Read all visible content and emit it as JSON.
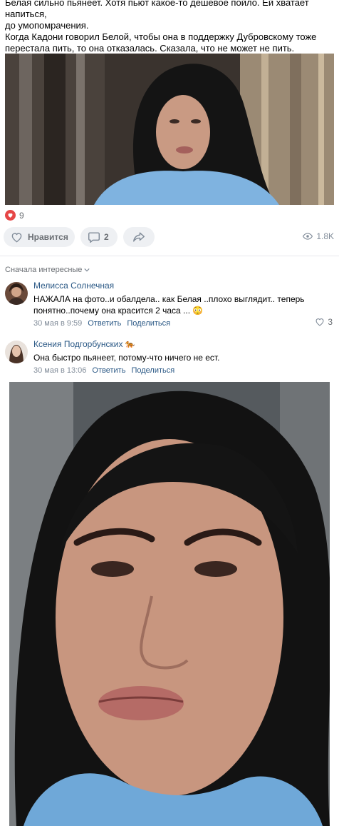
{
  "post": {
    "lines": [
      "Белая сильно пьянеет. Хотя пьют какое-то дешевое пойло. Ей хватает напиться,",
      "до умопомрачения.",
      "Когда Кадони говорил Белой, чтобы она в поддержку Дубровскому тоже",
      "перестала пить, то она отказалась. Сказала, что не может не пить."
    ]
  },
  "reactions": {
    "count": "9",
    "color": "#e64646"
  },
  "actions": {
    "like_label": "Нравится",
    "comments_count": "2",
    "views": "1.8K"
  },
  "comments_sort": {
    "label": "Сначала интересные"
  },
  "comments": [
    {
      "author": "Мелисса Солнечная",
      "text": "НАЖАЛА на фото..и обалдела.. как Белая ..плохо выглядит.. теперь понятно..почему она красится 2 часа ...",
      "emoji": "😳",
      "date": "30 мая в 9:59",
      "reply": "Ответить",
      "share": "Поделиться",
      "likes": "3"
    },
    {
      "author": "Ксения Подгорбунских",
      "author_badge": "🐅",
      "text": "Она быстро пьянеет, потому-что ничего не ест.",
      "date": "30 мая в 13:06",
      "reply": "Ответить",
      "share": "Поделиться"
    }
  ],
  "colors": {
    "link": "#2a5885",
    "muted": "#818c99",
    "pill": "#eef0f3"
  }
}
